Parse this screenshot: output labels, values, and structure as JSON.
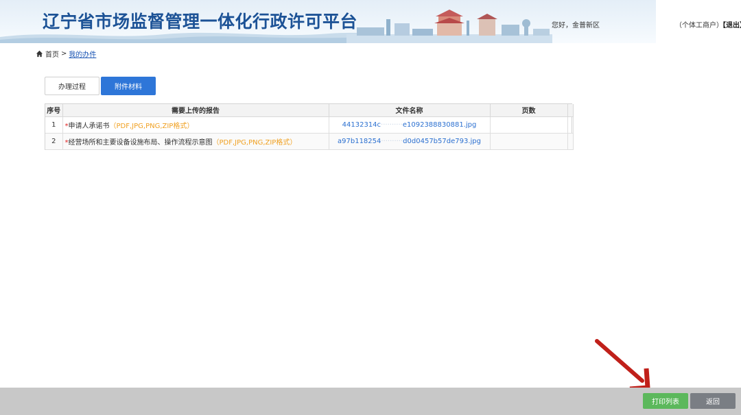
{
  "header": {
    "title": "辽宁省市场监督管理一体化行政许可平台",
    "greeting": "您好，金普新区",
    "greeting_blurred": " ",
    "user_type": "（个体工商户）",
    "logout": "【退出】"
  },
  "breadcrumb": {
    "home": "首页",
    "separator": ">",
    "current": "我的办件"
  },
  "tabs": [
    {
      "label": "办理过程",
      "active": false
    },
    {
      "label": "附件材料",
      "active": true
    }
  ],
  "table": {
    "headers": [
      "序号",
      "需要上传的报告",
      "文件名称",
      "页数"
    ],
    "rows": [
      {
        "no": "1",
        "required_mark": "*",
        "report": "申请人承诺书",
        "formats": "（PDF,JPG,PNG,ZIP格式）",
        "file_prefix": "44132314c",
        "file_mask": "··········",
        "file_suffix": "e1092388830881.jpg",
        "pages": ""
      },
      {
        "no": "2",
        "required_mark": "*",
        "report": "经营场所和主要设备设施布局、操作流程示意图",
        "formats": "（PDF,JPG,PNG,ZIP格式）",
        "file_prefix": "a97b118254",
        "file_mask": "··········",
        "file_suffix": "d0d0457b57de793.jpg",
        "pages": ""
      }
    ]
  },
  "footer": {
    "print_label": "打印列表",
    "back_label": "返回"
  },
  "colors": {
    "title": "#1c5296",
    "primary": "#2e76d8",
    "print_button": "#5cb85c",
    "back_button": "#7a7e84",
    "format_text": "#f0a020",
    "required_mark": "#e02020",
    "link": "#2a6fd0",
    "arrow": "#c0201a"
  }
}
